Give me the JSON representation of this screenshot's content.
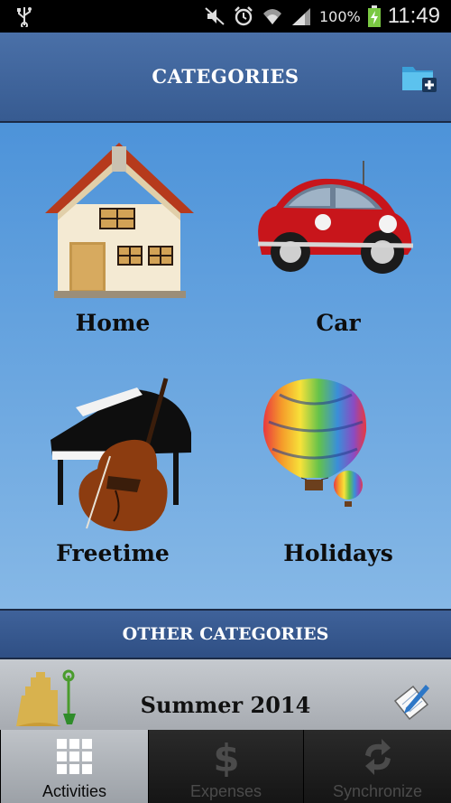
{
  "status_bar": {
    "battery_percent": "100%",
    "time": "11:49",
    "icons": [
      "usb-icon",
      "mute-icon",
      "alarm-icon",
      "wifi-icon",
      "signal-icon",
      "battery-charging-icon"
    ]
  },
  "header": {
    "title": "CATEGORIES",
    "action_icon": "add-folder-icon"
  },
  "categories": [
    {
      "label": "Home",
      "icon": "house-icon"
    },
    {
      "label": "Car",
      "icon": "car-icon"
    },
    {
      "label": "Freetime",
      "icon": "piano-cello-icon"
    },
    {
      "label": "Holidays",
      "icon": "hot-air-balloon-icon"
    }
  ],
  "other_categories": {
    "label": "OTHER CATEGORIES"
  },
  "activity": {
    "name": "Summer 2014",
    "icon": "sandcastle-icon",
    "edit_icon": "notepad-edit-icon"
  },
  "tabs": [
    {
      "label": "Activities",
      "icon": "grid-icon",
      "active": true
    },
    {
      "label": "Expenses",
      "icon": "dollar-icon",
      "active": false
    },
    {
      "label": "Synchronize",
      "icon": "sync-icon",
      "active": false
    }
  ],
  "colors": {
    "header_blue": "#3f649c",
    "grid_blue_top": "#4d93d9",
    "grid_blue_bottom": "#86b8e6"
  }
}
